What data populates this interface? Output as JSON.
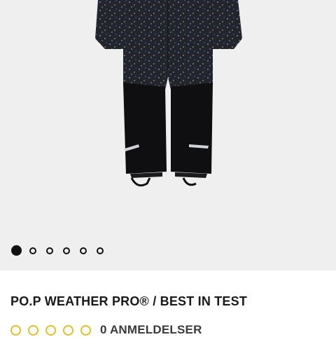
{
  "product": {
    "title": "PO.P WEATHER PRO® / BEST IN TEST",
    "reviews_label": "0 ANMELDELSER",
    "rating_max": 5,
    "rating_value": 0
  },
  "gallery": {
    "image_count": 6,
    "active_index": 0
  },
  "colors": {
    "gallery_bg": "#efefef",
    "rating_accent": "#e0c12a",
    "title_text": "#1a1a1a"
  }
}
